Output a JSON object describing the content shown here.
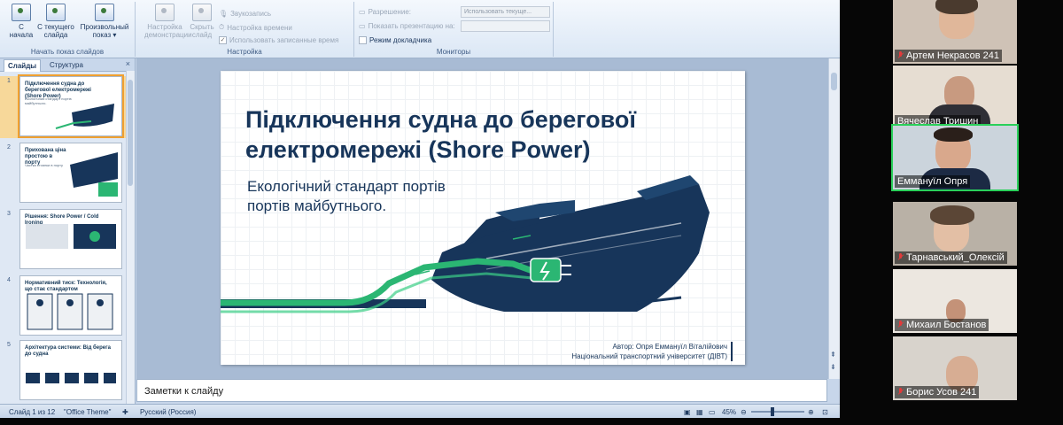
{
  "ribbon": {
    "start_group_label": "Начать показ слайдов",
    "btn_from_start": "С начала",
    "btn_from_current": "С текущего слайда",
    "btn_custom": "Произвольный показ",
    "setup_group_label": "Настройка",
    "btn_setup_show": "Настройка демонстрации",
    "btn_hide_slide": "Скрыть слайд",
    "opt_record": "Звукозапись",
    "opt_timings": "Настройка времени",
    "opt_use_timings": "Использовать записанные время",
    "monitors_group_label": "Мониторы",
    "resolution_label": "Разрешение:",
    "resolution_value": "Использовать текуще...",
    "show_on_label": "Показать презентацию на:",
    "show_on_value": "",
    "presenter_view": "Режим докладчика"
  },
  "left_pane": {
    "tab_slides": "Слайды",
    "tab_outline": "Структура",
    "close": "×",
    "thumbnails": [
      {
        "num": "1",
        "title": "Підключення судна до берегової електромережі (Shore Power)",
        "sub": "Екологічний стандарт портів майбутнього."
      },
      {
        "num": "2",
        "title": "Прихована ціна простою в порту",
        "sub": "Частка стоянки в порту"
      },
      {
        "num": "3",
        "title": "Рішення: Shore Power / Cold Ironing",
        "sub": ""
      },
      {
        "num": "4",
        "title": "Нормативний тиск: Технологія, що стає стандартом",
        "sub": ""
      },
      {
        "num": "5",
        "title": "Архітектура системи: Від берега до судна",
        "sub": ""
      }
    ]
  },
  "slide": {
    "title": "Підключення судна до берегової електромережі (Shore Power)",
    "subtitle_line1": "Екологічний стандарт портів",
    "subtitle_line2": "портів майбутнього.",
    "author_line1": "Автор: Опря Еммануїл Віталійович",
    "author_line2": "Національний транспортний університет (ДІВТ)"
  },
  "notes_placeholder": "Заметки к слайду",
  "status": {
    "slide_counter": "Слайд 1 из 12",
    "theme": "\"Office Theme\"",
    "language": "Русский (Россия)",
    "zoom": "45%"
  },
  "participants": [
    {
      "name": "Артем Некрасов 241",
      "muted": true,
      "active": false
    },
    {
      "name": "Вячеслав Тришин",
      "muted": false,
      "active": false
    },
    {
      "name": "Еммануїл Опря",
      "muted": false,
      "active": true
    },
    {
      "name": "Тарнавський_Олексій",
      "muted": true,
      "active": false
    },
    {
      "name": "Михаил Бостанов",
      "muted": true,
      "active": false
    },
    {
      "name": "Борис Усов 241",
      "muted": true,
      "active": false
    }
  ],
  "colors": {
    "accent": "#17355a",
    "green": "#2bb673",
    "active_border": "#2ad05a"
  }
}
